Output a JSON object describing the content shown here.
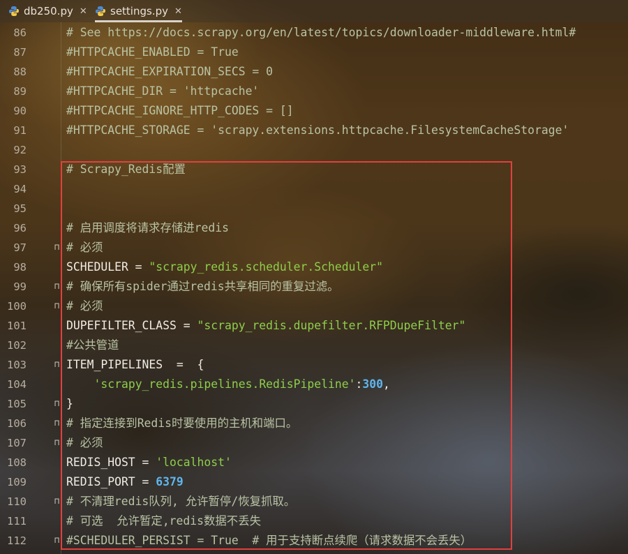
{
  "tabs": [
    {
      "label": "db250.py",
      "active": false,
      "icon": "python-file-icon"
    },
    {
      "label": "settings.py",
      "active": true,
      "icon": "python-file-icon"
    }
  ],
  "editor": {
    "lines": [
      {
        "num": "86",
        "text": "# See https://docs.scrapy.org/en/latest/topics/downloader-middleware.html#",
        "kind": "comment"
      },
      {
        "num": "87",
        "text": "#HTTPCACHE_ENABLED = True",
        "kind": "comment"
      },
      {
        "num": "88",
        "text": "#HTTPCACHE_EXPIRATION_SECS = 0",
        "kind": "comment"
      },
      {
        "num": "89",
        "text": "#HTTPCACHE_DIR = 'httpcache'",
        "kind": "comment"
      },
      {
        "num": "90",
        "text": "#HTTPCACHE_IGNORE_HTTP_CODES = []",
        "kind": "comment"
      },
      {
        "num": "91",
        "text": "#HTTPCACHE_STORAGE = 'scrapy.extensions.httpcache.FilesystemCacheStorage'",
        "kind": "comment"
      },
      {
        "num": "92",
        "text": "",
        "kind": "comment"
      },
      {
        "num": "93",
        "text": "# Scrapy_Redis配置",
        "kind": "comment"
      },
      {
        "num": "94",
        "text": "",
        "kind": "comment"
      },
      {
        "num": "95",
        "text": "",
        "kind": "comment"
      },
      {
        "num": "96",
        "text": "# 启用调度将请求存储进redis",
        "kind": "comment"
      },
      {
        "num": "97",
        "text": "# 必须",
        "kind": "comment"
      },
      {
        "num": "98",
        "text": "",
        "kind": "assign",
        "key": "SCHEDULER",
        "op": " = ",
        "value": "\"scrapy_redis.scheduler.Scheduler\""
      },
      {
        "num": "99",
        "text": "# 确保所有spider通过redis共享相同的重复过滤。",
        "kind": "comment"
      },
      {
        "num": "100",
        "text": "# 必须",
        "kind": "comment"
      },
      {
        "num": "101",
        "text": "",
        "kind": "assign",
        "key": "DUPEFILTER_CLASS",
        "op": " = ",
        "value": "\"scrapy_redis.dupefilter.RFPDupeFilter\""
      },
      {
        "num": "102",
        "text": "#公共管道",
        "kind": "comment"
      },
      {
        "num": "103",
        "text": "ITEM_PIPELINES  =  {",
        "kind": "plain"
      },
      {
        "num": "104",
        "text": "",
        "kind": "dictitem",
        "value": "'scrapy_redis.pipelines.RedisPipeline'",
        "sep": ":",
        "number": "300",
        "tail": ","
      },
      {
        "num": "105",
        "text": "}",
        "kind": "plain"
      },
      {
        "num": "106",
        "text": "# 指定连接到Redis时要使用的主机和端口。",
        "kind": "comment"
      },
      {
        "num": "107",
        "text": "# 必须",
        "kind": "comment"
      },
      {
        "num": "108",
        "text": "",
        "kind": "assign",
        "key": "REDIS_HOST",
        "op": " = ",
        "value": "'localhost'"
      },
      {
        "num": "109",
        "text": "",
        "kind": "assignnum",
        "key": "REDIS_PORT",
        "op": " = ",
        "value": "6379"
      },
      {
        "num": "110",
        "text": "# 不清理redis队列, 允许暂停/恢复抓取。",
        "kind": "comment"
      },
      {
        "num": "111",
        "text": "# 可选  允许暂定,redis数据不丢失",
        "kind": "comment"
      },
      {
        "num": "112",
        "text": "#SCHEDULER_PERSIST = True  # 用于支持断点续爬（请求数据不会丢失）",
        "kind": "comment"
      }
    ]
  },
  "colors": {
    "highlight_border": "#e2403e",
    "string": "#8fce4b",
    "number": "#5fb6ee",
    "comment": "#b9c3a4"
  }
}
